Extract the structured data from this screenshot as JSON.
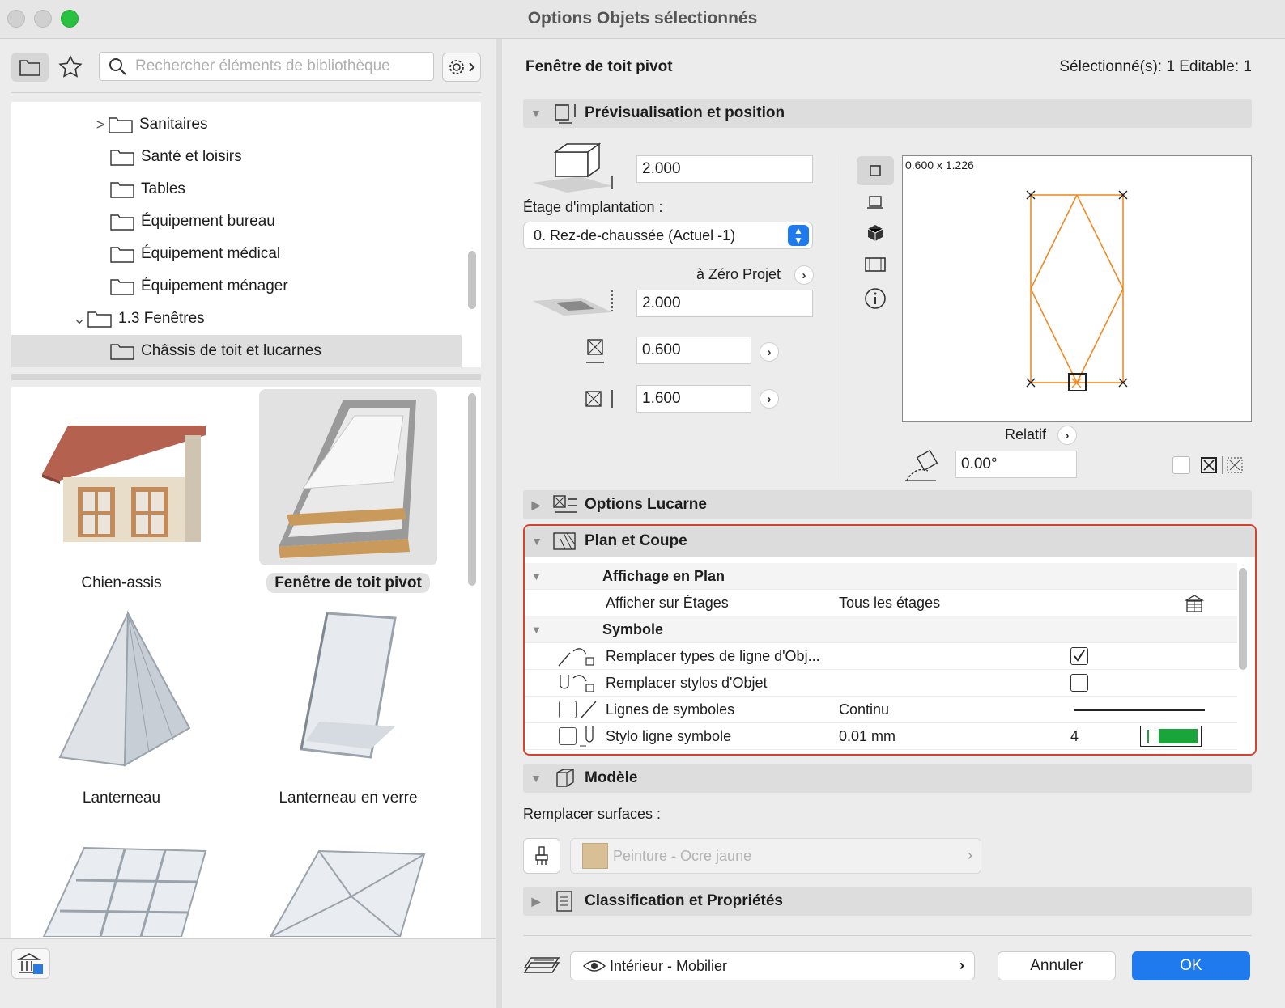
{
  "window": {
    "title": "Options Objets sélectionnés"
  },
  "library": {
    "search_placeholder": "Rechercher éléments de bibliothèque",
    "tree": [
      {
        "label": "Sanitaires",
        "chevron": ">"
      },
      {
        "label": "Santé et loisirs"
      },
      {
        "label": "Tables"
      },
      {
        "label": "Équipement bureau"
      },
      {
        "label": "Équipement médical"
      },
      {
        "label": "Équipement ménager"
      },
      {
        "label": "1.3 Fenêtres",
        "chevron": "⌄"
      },
      {
        "label": "Châssis de toit et lucarnes",
        "selected": true
      }
    ],
    "gallery": [
      {
        "label": "Chien-assis"
      },
      {
        "label": "Fenêtre de toit pivot",
        "selected": true
      },
      {
        "label": "Lanterneau"
      },
      {
        "label": "Lanterneau en verre"
      }
    ]
  },
  "header": {
    "object_name": "Fenêtre de toit pivot",
    "selection_info": "Sélectionné(s): 1 Editable: 1"
  },
  "preview_position": {
    "title": "Prévisualisation et position",
    "elevation_value": "2.000",
    "story_label": "Étage d'implantation :",
    "story_value": "0. Rez-de-chaussée (Actuel -1)",
    "zero_label": "à Zéro Projet",
    "zero_value": "2.000",
    "width_value": "0.600",
    "height_value": "1.600",
    "dimension_caption": "0.600 x 1.226",
    "relative_label": "Relatif",
    "angle_value": "0.00°"
  },
  "sections": {
    "options_lucarne": "Options Lucarne",
    "plan_coupe": "Plan et Coupe",
    "modele": "Modèle",
    "classification": "Classification et Propriétés"
  },
  "plan_coupe": {
    "group1": "Affichage en Plan",
    "row_etages_label": "Afficher sur Étages",
    "row_etages_value": "Tous les étages",
    "group2": "Symbole",
    "row_types_label": "Remplacer types de ligne d'Obj...",
    "row_types_checked": true,
    "row_stylos_label": "Remplacer stylos d'Objet",
    "row_stylos_checked": false,
    "row_lignes_label": "Lignes de symboles",
    "row_lignes_value": "Continu",
    "row_stylo_label": "Stylo ligne symbole",
    "row_stylo_value": "0.01 mm",
    "row_stylo_pen": "4",
    "pen_color": "#1aa53a"
  },
  "modele": {
    "surface_label": "Remplacer surfaces :",
    "surface_value": "Peinture - Ocre jaune",
    "surface_color": "#d9bf94"
  },
  "footer": {
    "layer_value": "Intérieur - Mobilier",
    "cancel_label": "Annuler",
    "ok_label": "OK"
  },
  "colors": {
    "accent": "#1f7aed",
    "highlight": "#d9412f",
    "preview_lines": "#f08a24"
  }
}
